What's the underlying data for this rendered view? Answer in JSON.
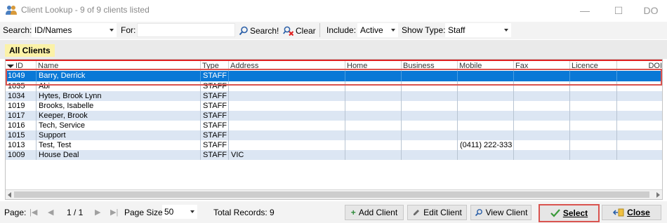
{
  "window": {
    "title": "Client Lookup - 9 of 9 clients listed",
    "minimize_glyph": "—",
    "maximize_glyph": "☐",
    "close_glyph": "DO"
  },
  "toolbar": {
    "search_label": "Search:",
    "search_by": "ID/Names",
    "for_label": "For:",
    "for_value": "",
    "search_button": "Search!",
    "clear_button": "Clear",
    "include_label": "Include:",
    "include_value": "Active",
    "show_type_label": "Show Type:",
    "show_type_value": "Staff"
  },
  "group": {
    "title": "All Clients"
  },
  "grid": {
    "columns": [
      "ID",
      "Name",
      "Type",
      "Address",
      "Home",
      "Business",
      "Mobile",
      "Fax",
      "Licence",
      "DOI"
    ],
    "rows": [
      {
        "id": "1049",
        "name": "Barry, Derrick",
        "type": "STAFF",
        "address": "",
        "mobile": ""
      },
      {
        "id": "1035",
        "name": "Abi",
        "type": "STAFF",
        "address": "",
        "mobile": ""
      },
      {
        "id": "1034",
        "name": "Hytes, Brook Lynn",
        "type": "STAFF",
        "address": "",
        "mobile": ""
      },
      {
        "id": "1019",
        "name": "Brooks, Isabelle",
        "type": "STAFF",
        "address": "",
        "mobile": ""
      },
      {
        "id": "1017",
        "name": "Keeper, Brook",
        "type": "STAFF",
        "address": "",
        "mobile": ""
      },
      {
        "id": "1016",
        "name": "Tech, Service",
        "type": "STAFF",
        "address": "",
        "mobile": ""
      },
      {
        "id": "1015",
        "name": "Support",
        "type": "STAFF",
        "address": "",
        "mobile": ""
      },
      {
        "id": "1013",
        "name": "Test, Test",
        "type": "STAFF",
        "address": "",
        "mobile": "(0411) 222-333"
      },
      {
        "id": "1009",
        "name": "House Deal",
        "type": "STAFF",
        "address": "VIC",
        "mobile": ""
      }
    ],
    "selected_row": 0
  },
  "footer": {
    "page_label": "Page:",
    "page_indicator": "1 / 1",
    "page_size_label": "Page Size:",
    "page_size_value": "50",
    "total_records": "Total Records: 9",
    "add_client": "Add Client",
    "edit_client": "Edit Client",
    "view_client": "View Client",
    "select": "Select",
    "close": "Close"
  },
  "colors": {
    "selection": "#0a78d6",
    "alt_row": "#dce6f3",
    "group_tab": "#fbf2a8",
    "highlight_outline": "#d9534f"
  }
}
